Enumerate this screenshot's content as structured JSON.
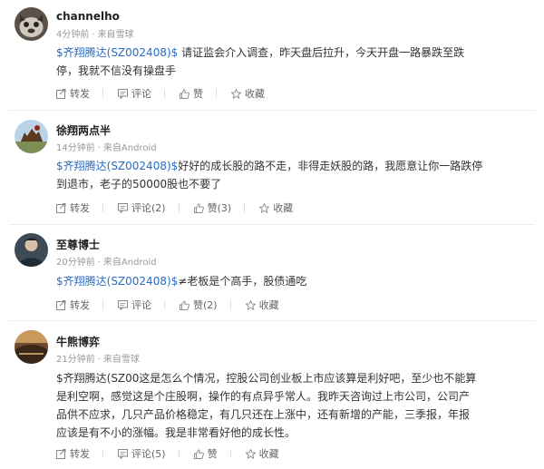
{
  "posts": [
    {
      "user": "channelho",
      "time": "4分钟前",
      "source": "来自雪球",
      "stock_tag": "$齐翔腾达(SZ002408)$",
      "text_line1": " 请证监会介入调查，昨天盘后拉升，今天开盘一路暴跌至跌",
      "text_line2": "停，我就不信没有操盘手",
      "actions": {
        "repost": "转发",
        "comment": "评论",
        "like": "赞",
        "favorite": "收藏"
      }
    },
    {
      "user": "徐翔两点半",
      "time": "14分钟前",
      "source": "来自Android",
      "stock_tag": "$齐翔腾达(SZ002408)$",
      "text_line1": "好好的成长股的路不走，非得走妖股的路，我愿意让你一路跌停",
      "text_line2": "到退市，老子的50000股也不要了",
      "actions": {
        "repost": "转发",
        "comment": "评论(2)",
        "like": "赞(3)",
        "favorite": "收藏"
      }
    },
    {
      "user": "至尊博士",
      "time": "20分钟前",
      "source": "来自Android",
      "stock_tag": "$齐翔腾达(SZ002408)$",
      "text_line1": "≠老板是个高手，股债通吃",
      "actions": {
        "repost": "转发",
        "comment": "评论",
        "like": "赞(2)",
        "favorite": "收藏"
      }
    },
    {
      "user": "牛熊博弈",
      "time": "21分钟前",
      "source": "来自雪球",
      "text_line1": "$齐翔腾达(SZ00这是怎么个情况，控股公司创业板上市应该算是利好吧，至少也不能算",
      "text_line2": "是利空啊，感觉这是个庄股啊，操作的有点异乎常人。我昨天咨询过上市公司，公司产",
      "text_line3": "品供不应求，几只产品价格稳定，有几只还在上涨中，还有新增的产能，三季报，年报",
      "text_line4": "应该是有不小的涨幅。我是非常看好他的成长性。",
      "actions": {
        "repost": "转发",
        "comment": "评论(5)",
        "like": "赞",
        "favorite": "收藏"
      }
    }
  ],
  "colors": {
    "link": "#2b6bbf",
    "meta": "#999999",
    "action": "#666666"
  },
  "icons": [
    "repost-icon",
    "comment-icon",
    "like-icon",
    "favorite-icon"
  ]
}
